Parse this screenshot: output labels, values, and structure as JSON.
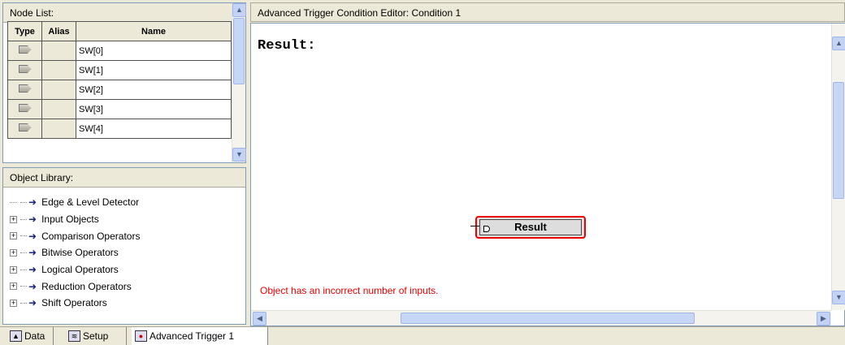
{
  "node_list": {
    "title": "Node List:",
    "columns": [
      "Type",
      "Alias",
      "Name"
    ],
    "rows": [
      {
        "name": "SW[0]"
      },
      {
        "name": "SW[1]"
      },
      {
        "name": "SW[2]"
      },
      {
        "name": "SW[3]"
      },
      {
        "name": "SW[4]"
      }
    ]
  },
  "object_library": {
    "title": "Object Library:",
    "items": [
      {
        "label": "Edge & Level Detector",
        "expandable": false
      },
      {
        "label": "Input Objects",
        "expandable": true
      },
      {
        "label": "Comparison Operators",
        "expandable": true
      },
      {
        "label": "Bitwise Operators",
        "expandable": true
      },
      {
        "label": "Logical Operators",
        "expandable": true
      },
      {
        "label": "Reduction Operators",
        "expandable": true
      },
      {
        "label": "Shift Operators",
        "expandable": true
      }
    ]
  },
  "editor": {
    "title": "Advanced Trigger Condition Editor: Condition 1",
    "result_label": "Result:",
    "result_node_label": "Result",
    "error_message": "Object has an incorrect number of inputs."
  },
  "tabs": [
    {
      "label": "Data",
      "icon": "data-icon"
    },
    {
      "label": "Setup",
      "icon": "setup-icon"
    },
    {
      "label": "Advanced Trigger 1",
      "icon": "trigger-icon"
    }
  ],
  "colors": {
    "error": "#e00000",
    "result_border": "#e00000"
  }
}
